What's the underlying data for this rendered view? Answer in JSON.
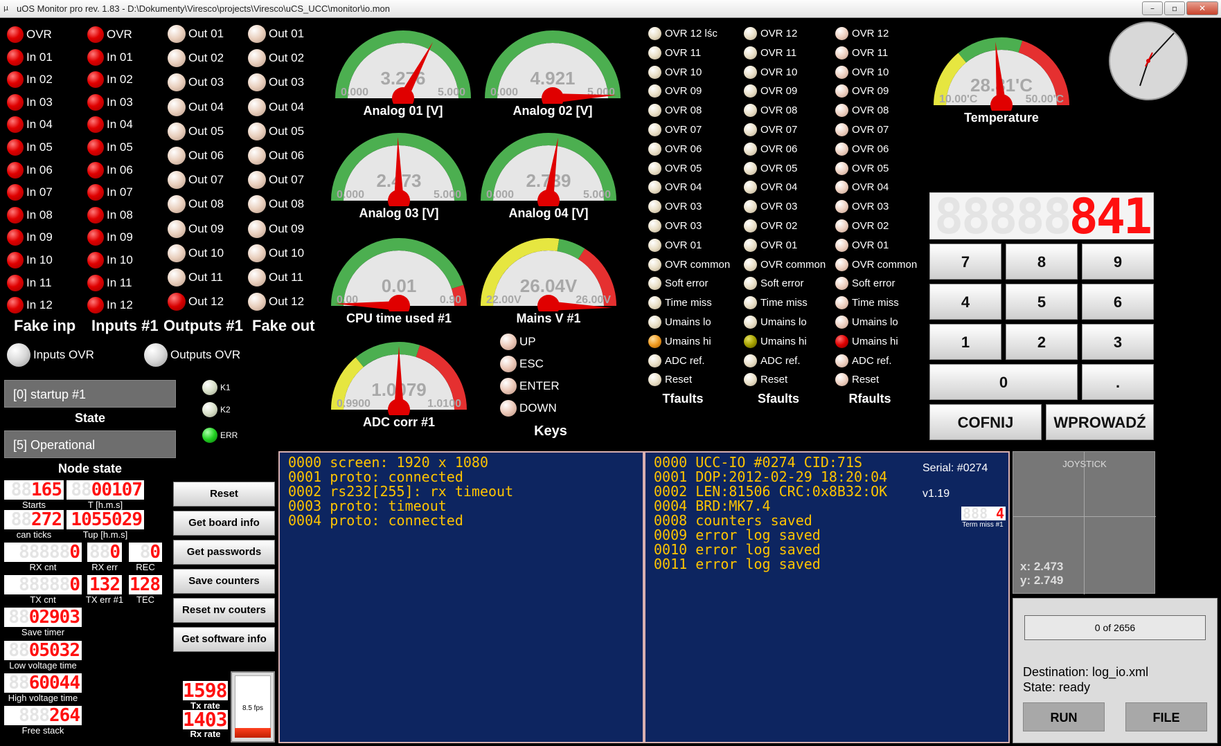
{
  "window": {
    "title": "uOS Monitor pro rev. 1.83 - D:\\Dokumenty\\Viresco\\projects\\Viresco\\uCS_UCC\\monitor\\io.mon",
    "minimize": "–",
    "maximize": "▫",
    "close": "✕"
  },
  "fake_inp": {
    "label": "Fake inp",
    "items": [
      "OVR",
      "In 01",
      "In 02",
      "In 03",
      "In 04",
      "In 05",
      "In 06",
      "In 07",
      "In 08",
      "In 09",
      "In 10",
      "In 11",
      "In 12"
    ]
  },
  "inputs1": {
    "label": "Inputs #1",
    "items": [
      "OVR",
      "In 01",
      "In 02",
      "In 03",
      "In 04",
      "In 05",
      "In 06",
      "In 07",
      "In 08",
      "In 09",
      "In 10",
      "In 11",
      "In 12"
    ]
  },
  "outputs1": {
    "label": "Outputs #1",
    "items": [
      "Out 01",
      "Out 02",
      "Out 03",
      "Out 04",
      "Out 05",
      "Out 06",
      "Out 07",
      "Out 08",
      "Out 09",
      "Out 10",
      "Out 11",
      "Out 12"
    ]
  },
  "fake_out": {
    "label": "Fake out",
    "items": [
      "Out 01",
      "Out 02",
      "Out 03",
      "Out 04",
      "Out 05",
      "Out 06",
      "Out 07",
      "Out 08",
      "Out 09",
      "Out 10",
      "Out 11",
      "Out 12"
    ]
  },
  "ovr_indicators": {
    "inputs": "Inputs OVR",
    "outputs": "Outputs OVR"
  },
  "gauges": [
    {
      "id": "analog01",
      "label": "Analog 01 [V]",
      "value": "3.276",
      "min": "0.000",
      "max": "5.000",
      "fraction": 0.655,
      "zones": "green"
    },
    {
      "id": "analog02",
      "label": "Analog 02 [V]",
      "value": "4.921",
      "min": "0.000",
      "max": "5.000",
      "fraction": 0.984,
      "zones": "green"
    },
    {
      "id": "analog03",
      "label": "Analog 03 [V]",
      "value": "2.473",
      "min": "0.000",
      "max": "5.000",
      "fraction": 0.495,
      "zones": "green"
    },
    {
      "id": "analog04",
      "label": "Analog 04 [V]",
      "value": "2.739",
      "min": "0.000",
      "max": "5.000",
      "fraction": 0.548,
      "zones": "green"
    },
    {
      "id": "cpu",
      "label": "CPU time used #1",
      "value": "0.01",
      "min": "0.00",
      "max": "0.90",
      "fraction": 0.011,
      "zones": "green-red"
    },
    {
      "id": "mains",
      "label": "Mains V #1",
      "value": "26.04V",
      "min": "22.00V",
      "max": "26.00V",
      "fraction": 1.01,
      "zones": "yellow-green-red"
    },
    {
      "id": "adc",
      "label": "ADC corr #1",
      "value": "1.0079",
      "min": "0.9900",
      "max": "1.0100",
      "fraction": 0.5,
      "zones": "yellow-green-red"
    },
    {
      "id": "temp",
      "label": "Temperature",
      "value": "28.81'C",
      "min": "10.00'C",
      "max": "50.00'C",
      "fraction": 0.47,
      "zones": "yellow-green-red"
    }
  ],
  "keys": {
    "label": "Keys",
    "items": [
      "UP",
      "ESC",
      "ENTER",
      "DOWN"
    ]
  },
  "faults": [
    {
      "label": "Tfaults",
      "color": "sm",
      "items": [
        "OVR 12 lśc",
        "OVR 11",
        "OVR 10",
        "OVR 09",
        "OVR 08",
        "OVR 07",
        "OVR 06",
        "OVR 05",
        "OVR 04",
        "OVR 03",
        "OVR 03",
        "OVR 01",
        "OVR common",
        "Soft error",
        "Time miss",
        "Umains lo",
        "Umains hi",
        "ADC ref.",
        "Reset"
      ],
      "active_index": 16,
      "active_color": "orange"
    },
    {
      "label": "Sfaults",
      "color": "sm",
      "items": [
        "OVR 12",
        "OVR 11",
        "OVR 10",
        "OVR 09",
        "OVR 08",
        "OVR 07",
        "OVR 06",
        "OVR 05",
        "OVR 04",
        "OVR 03",
        "OVR 02",
        "OVR 01",
        "OVR common",
        "Soft error",
        "Time miss",
        "Umains lo",
        "Umains hi",
        "ADC ref.",
        "Reset"
      ],
      "active_index": 16,
      "active_color": "olive"
    },
    {
      "label": "Rfaults",
      "color": "peach",
      "items": [
        "OVR 12",
        "OVR 11",
        "OVR 10",
        "OVR 09",
        "OVR 08",
        "OVR 07",
        "OVR 06",
        "OVR 05",
        "OVR 04",
        "OVR 03",
        "OVR 02",
        "OVR 01",
        "OVR common",
        "Soft error",
        "Time miss",
        "Umains lo",
        "Umains hi",
        "ADC ref.",
        "Reset"
      ],
      "active_index": 16,
      "active_color": "redsm"
    }
  ],
  "keypad": {
    "display_value": "841",
    "display_ghost": "88888",
    "keys": [
      "7",
      "8",
      "9",
      "4",
      "5",
      "6",
      "1",
      "2",
      "3",
      "0",
      "."
    ],
    "back": "COFNIJ",
    "enter": "WPROWADŹ"
  },
  "state": {
    "state_value": "[0] startup #1",
    "state_label": "State",
    "node_value": "[5] Operational",
    "node_label": "Node state"
  },
  "status_leds": [
    "K1",
    "K2",
    "ERR"
  ],
  "counters": [
    {
      "label": "Starts",
      "value": "165",
      "ghost": "88"
    },
    {
      "label": "T [h.m.s]",
      "value": "00107",
      "ghost": "88"
    },
    {
      "label": "can ticks",
      "value": "272",
      "ghost": "88"
    },
    {
      "label": "Tup [h.m.s]",
      "value": "1055029",
      "ghost": ""
    },
    {
      "label": "RX cnt",
      "value": "0",
      "ghost": "88888"
    },
    {
      "label": "RX err",
      "value": "0",
      "ghost": "88"
    },
    {
      "label": "REC",
      "value": "0",
      "ghost": "8"
    },
    {
      "label": "TX cnt",
      "value": "0",
      "ghost": "88888"
    },
    {
      "label": "TX err #1",
      "value": "132",
      "ghost": ""
    },
    {
      "label": "TEC",
      "value": "128",
      "ghost": ""
    },
    {
      "label": "Save timer",
      "value": "02903",
      "ghost": "88"
    },
    {
      "label": "Low voltage time",
      "value": "05032",
      "ghost": "88"
    },
    {
      "label": "High voltage time",
      "value": "60044",
      "ghost": "88"
    },
    {
      "label": "Free stack",
      "value": "264",
      "ghost": "888"
    }
  ],
  "buttons": [
    "Reset",
    "Get board info",
    "Get passwords",
    "Save counters",
    "Reset nv couters",
    "Get software info"
  ],
  "rates": {
    "tx_value": "1598",
    "tx_label": "Tx rate",
    "rx_value": "1403",
    "rx_label": "Rx rate",
    "fps": "8.5 fps"
  },
  "term1": [
    "0000 screen: 1920 x 1080",
    "0001 proto: connected",
    "0002 rs232[255]: rx timeout",
    "0003 proto: timeout",
    "0004 proto: connected"
  ],
  "term2": [
    "0000 UCC-IO #0274 CID:71S",
    "0001 DOP:2012-02-29 18:20:04",
    "0002 LEN:81506 CRC:0x8B32:OK",
    "0004 BRD:MK7.4",
    "0008 counters saved",
    "0009 error log saved",
    "0010 error log saved",
    "0011 error log saved"
  ],
  "serial": {
    "serial": "Serial: #0274",
    "version": "v1.19",
    "term_miss_value": "4",
    "term_miss_ghost": "888",
    "term_miss_label": "Term miss #1"
  },
  "joystick": {
    "title": "JOYSTICK",
    "x": "x: 2.473",
    "y": "y: 2.749",
    "x_value": 2.473,
    "y_value": 2.749
  },
  "logger": {
    "progress": "0 of 2656",
    "destination": "Destination: log_io.xml",
    "state": "State: ready",
    "run": "RUN",
    "file": "FILE"
  }
}
